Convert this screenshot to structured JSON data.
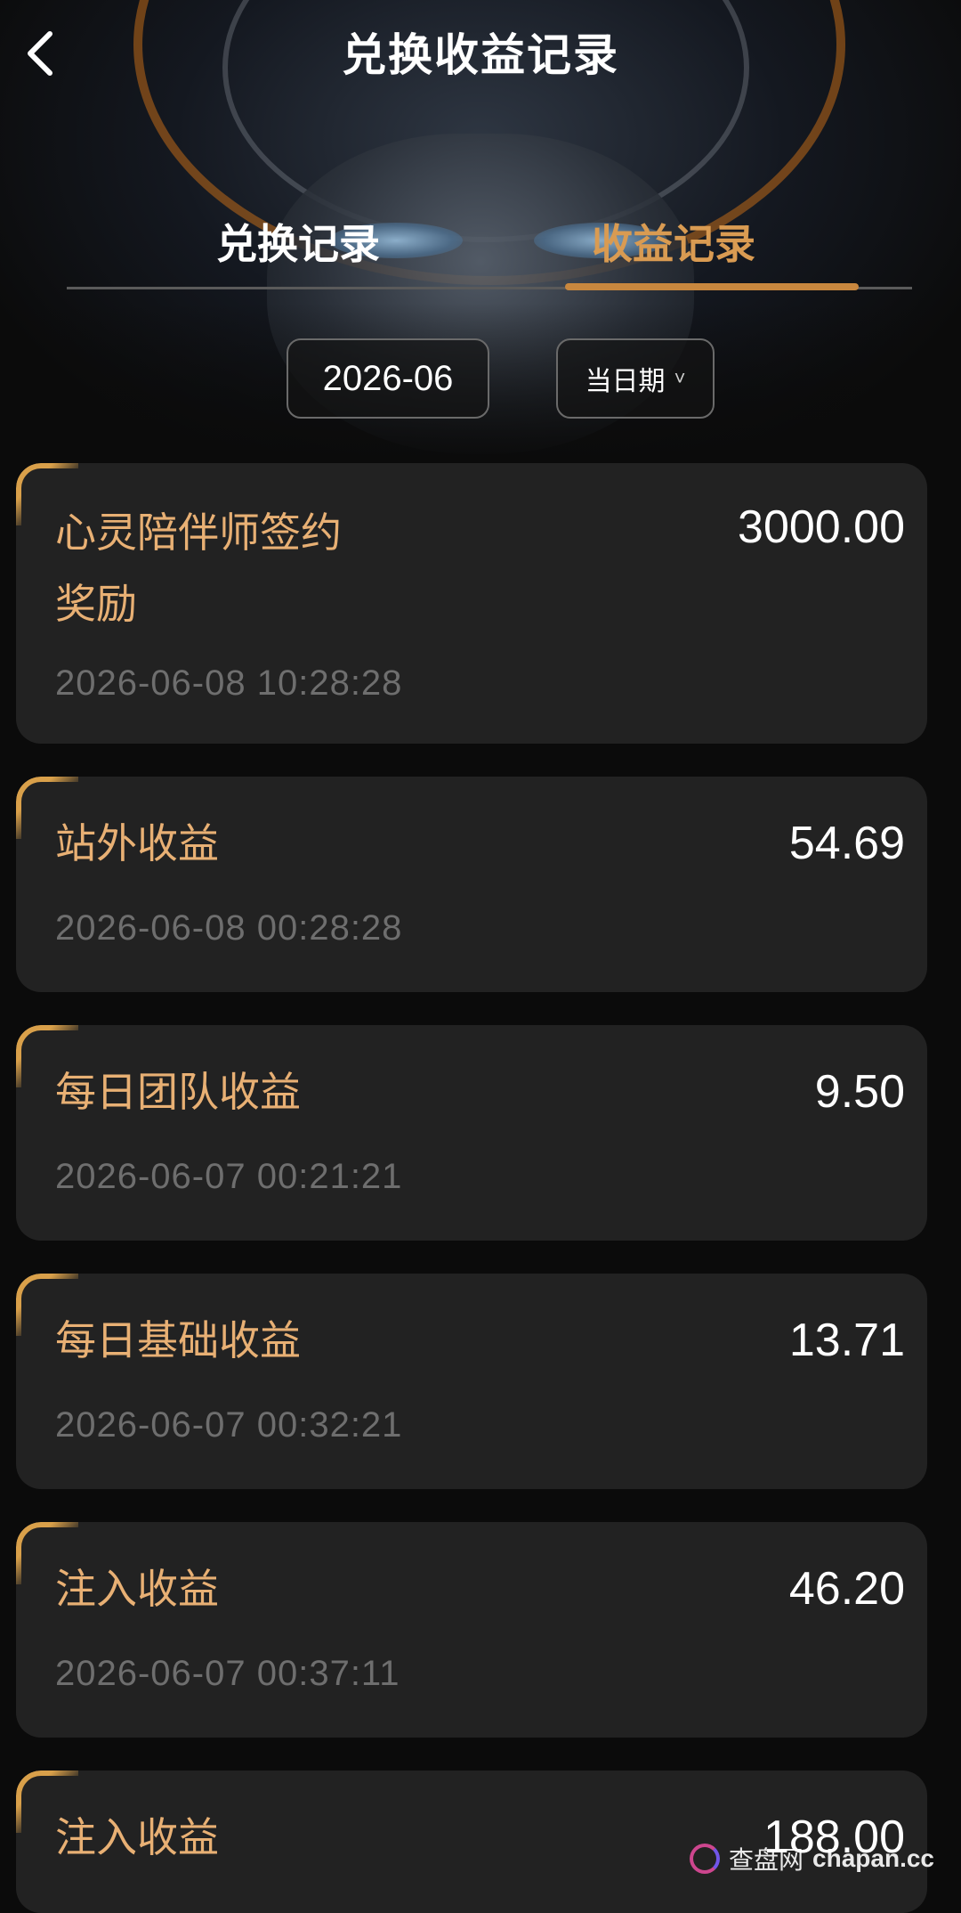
{
  "header": {
    "title": "兑换收益记录"
  },
  "tabs": [
    {
      "label": "兑换记录",
      "active": false
    },
    {
      "label": "收益记录",
      "active": true
    }
  ],
  "filters": {
    "date": "2026-06",
    "mode": "当日期"
  },
  "records": [
    {
      "name": "心灵陪伴师签约\n奖励",
      "amount": "3000.00",
      "time": "2026-06-08 10:28:28"
    },
    {
      "name": "站外收益",
      "amount": "54.69",
      "time": "2026-06-08 00:28:28"
    },
    {
      "name": "每日团队收益",
      "amount": "9.50",
      "time": "2026-06-07 00:21:21"
    },
    {
      "name": "每日基础收益",
      "amount": "13.71",
      "time": "2026-06-07 00:32:21"
    },
    {
      "name": "注入收益",
      "amount": "46.20",
      "time": "2026-06-07 00:37:11"
    },
    {
      "name": "注入收益",
      "amount": "188.00",
      "time": ""
    }
  ],
  "watermark": {
    "cn": "查盘网",
    "site": "chapan.cc"
  },
  "colors": {
    "accent_gold": "#d99b52",
    "card_bg": "#222222",
    "time_gray": "#6e6e6e"
  }
}
